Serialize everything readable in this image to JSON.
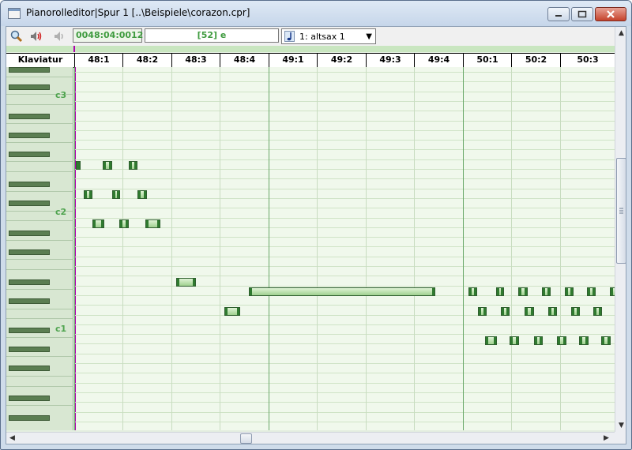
{
  "window": {
    "title": "Pianorolleditor|Spur 1 [..\\Beispiele\\corazon.cpr]"
  },
  "toolbar": {
    "position": "0048:04:0012",
    "note": "[52] e",
    "track": "1: altsax 1",
    "icons": [
      "magnifier-icon",
      "speaker-on-icon",
      "speaker-off-icon",
      "note-icon"
    ]
  },
  "ruler": {
    "keyboard_label": "Klaviatur",
    "beats": [
      "48:1",
      "48:2",
      "48:3",
      "48:4",
      "49:1",
      "49:2",
      "49:3",
      "49:4",
      "50:1",
      "50:2",
      "50:3"
    ]
  },
  "keyboard": {
    "labels": [
      "c3",
      "c2",
      "c1"
    ]
  },
  "colors": {
    "cursor": "#b000b0",
    "note_fill": "#9fd08f",
    "grid_bg": "#f0f8ec",
    "octave_label": "#4fa44f"
  }
}
